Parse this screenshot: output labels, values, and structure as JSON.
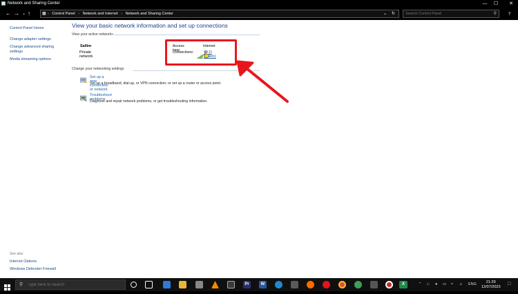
{
  "window": {
    "title": "Network and Sharing Center",
    "controls": {
      "minimize": "—",
      "maximize": "☐",
      "close": "✕"
    }
  },
  "address_bar": {
    "crumbs": [
      "Control Panel",
      "Network and Internet",
      "Network and Sharing Center"
    ],
    "search_placeholder": "Search Control Panel"
  },
  "sidebar": {
    "links": [
      "Control Panel Home",
      "Change adapter settings",
      "Change advanced sharing",
      "settings",
      "Media streaming options"
    ],
    "see_also_title": "See also",
    "see_also_links": [
      "Internet Options",
      "Windows Defender Firewall"
    ]
  },
  "main": {
    "heading": "View your basic network information and set up connections",
    "active_networks_label": "View your active networks",
    "network": {
      "name": "Sallim",
      "type": "Private network",
      "access_type_label": "Access type:",
      "access_type_value": "Internet",
      "connections_label": "Connections:",
      "connection_link": "Wi-Fi (Sallim)"
    },
    "change_settings_label": "Change your networking settings",
    "tasks": [
      {
        "link": "Set up a new connection or network",
        "description": "Set up a broadband, dial-up, or VPN connection; or set up a router or access point."
      },
      {
        "link": "Troubleshoot problems",
        "description": "Diagnose and repair network problems, or get troubleshooting information."
      }
    ]
  },
  "annotation": {
    "color": "#e8161c"
  },
  "taskbar": {
    "search_placeholder": "Type here to search",
    "language": "ENG",
    "time": "21:29",
    "date": "12/07/2023"
  },
  "colors": {
    "link": "#1a5fb4",
    "heading": "#1e3f8a",
    "taskbar": "#101010"
  }
}
